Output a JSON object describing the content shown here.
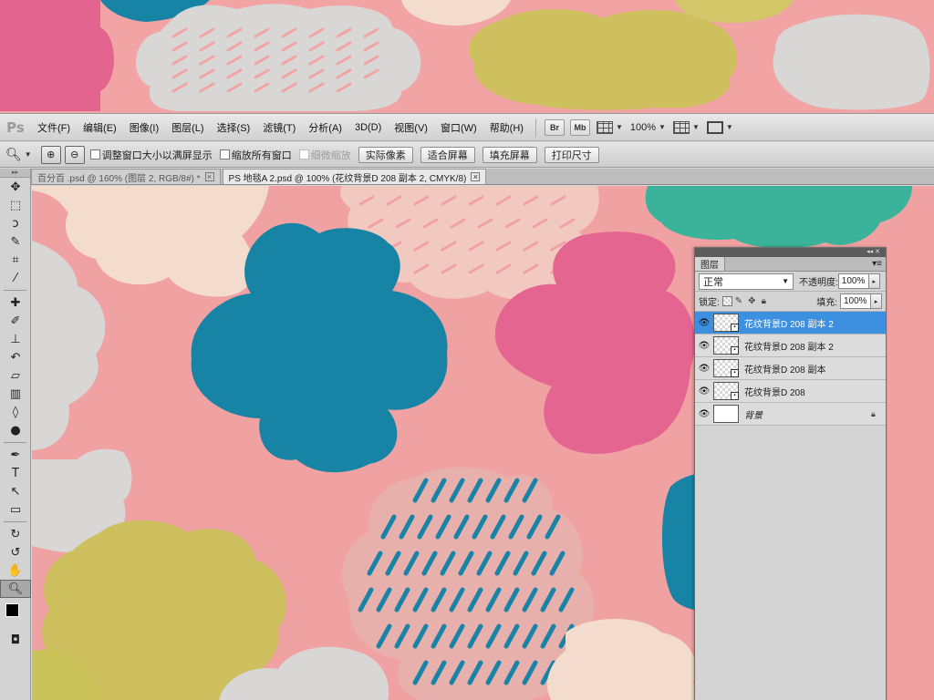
{
  "app": {
    "logo": "Ps"
  },
  "menu": [
    "文件(F)",
    "编辑(E)",
    "图像(I)",
    "图层(L)",
    "选择(S)",
    "滤镜(T)",
    "分析(A)",
    "3D(D)",
    "视图(V)",
    "窗口(W)",
    "帮助(H)"
  ],
  "app_bar": {
    "bridge": "Br",
    "mini_bridge": "Mb",
    "zoom": "100%"
  },
  "options": {
    "resize_windows": "调整窗口大小以满屏显示",
    "zoom_all": "缩放所有窗口",
    "scrubby_zoom": "细微缩放",
    "actual_pixels": "实际像素",
    "fit_screen": "适合屏幕",
    "fill_screen": "填充屏幕",
    "print_size": "打印尺寸"
  },
  "tabs": [
    {
      "label": "百分百 .psd @ 160% (图层 2, RGB/8#) *"
    },
    {
      "label": "PS 地毯A 2.psd @ 100% (花纹背景D 208 副本 2, CMYK/8)"
    }
  ],
  "layers_panel": {
    "title": "图层",
    "blend_mode": "正常",
    "opacity_label": "不透明度:",
    "opacity": "100%",
    "lock_label": "锁定:",
    "fill_label": "填充:",
    "fill": "100%",
    "layers": [
      {
        "name": "花纹背景D 208 副本 2",
        "selected": true
      },
      {
        "name": "花纹背景D 208 副本 2",
        "selected": false
      },
      {
        "name": "花纹背景D 208 副本",
        "selected": false
      },
      {
        "name": "花纹背景D 208",
        "selected": false
      },
      {
        "name": "背景",
        "selected": false
      }
    ]
  },
  "colors": {
    "canvas_bg": "#f0a2a2",
    "teal_blue": "#1784a6",
    "magenta_pink": "#e56591",
    "olive_yellow": "#cfc05f",
    "light_gray": "#d9d6d6",
    "cream": "#f3dccd",
    "green_teal": "#3ab39a",
    "selection_blue": "#3d8fe0"
  }
}
